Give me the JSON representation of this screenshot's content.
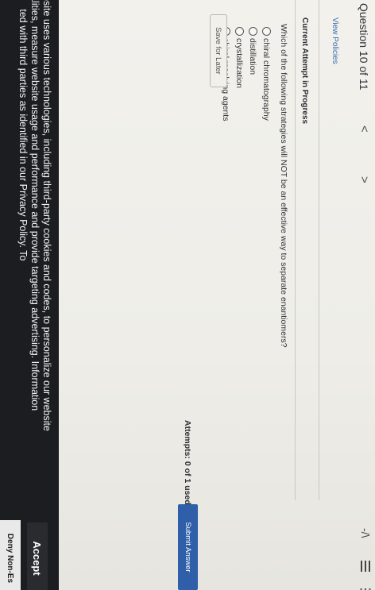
{
  "header": {
    "question_counter": "Question 10 of 11",
    "prev_glyph": "<",
    "next_glyph": ">",
    "top_right_glyph": "-/\\",
    "icons": [
      "chevron-left-icon",
      "chevron-right-icon",
      "menu-icon",
      "more-icon"
    ]
  },
  "links": {
    "view_policies": "View Policies"
  },
  "attempt_status": "Current Attempt in Progress",
  "question": {
    "text": "Which of the following strategies will NOT be an effective way to separate enantiomers?",
    "options": [
      "chiral chromatography",
      "distillation",
      "crystallization",
      "chiral resolving agents"
    ]
  },
  "actions": {
    "save_later": "Save for Later",
    "attempts": "Attempts: 0 of 1 used",
    "submit": "Submit Answer"
  },
  "cookie_banner": {
    "lines": [
      "osite uses various technologies, including third-party cookies and codes, to personalize our website",
      "alities, measure website usage and performance and provide targeting advertising. Information",
      "     ted with third parties as identified in our Privacy Policy. To"
    ],
    "accept": "Accept",
    "deny": "Deny Non-Es"
  },
  "colors": {
    "page_bg": "#f2f1ec",
    "link": "#3a6fb0",
    "submit_bg": "#2f5fa8",
    "banner_bg": "#1c1d20"
  }
}
